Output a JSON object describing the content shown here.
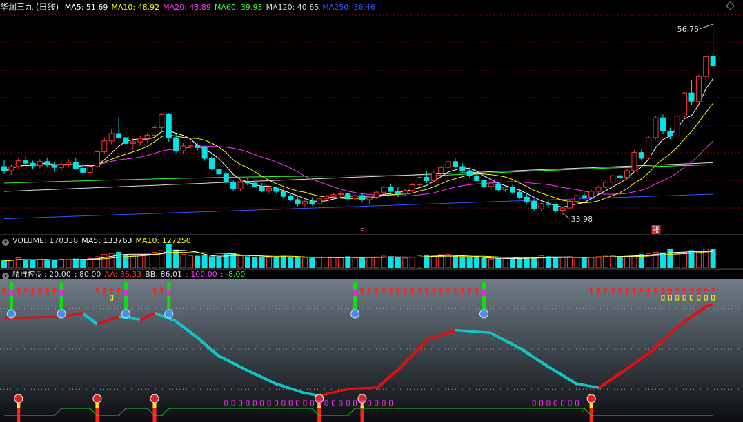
{
  "price_header": {
    "title": "华润三九 (日线)",
    "ma": [
      {
        "label": "MA5:",
        "value": "51.69",
        "color": "#ffffff"
      },
      {
        "label": "MA10:",
        "value": "48.92",
        "color": "#ffff00"
      },
      {
        "label": "MA20:",
        "value": "43.89",
        "color": "#ff33ff"
      },
      {
        "label": "MA60:",
        "value": "39.93",
        "color": "#33ff33"
      },
      {
        "label": "MA120:",
        "value": "40.65",
        "color": "#dddddd"
      },
      {
        "label": "MA250:",
        "value": "36.46",
        "color": "#3355ff"
      }
    ],
    "high_label": "56.75",
    "low_label": "33.98",
    "marker_s": "S",
    "marker_zhang": "涨"
  },
  "volume_header": {
    "items": [
      {
        "label": "VOLUME:",
        "value": "170338",
        "color": "#dddddd"
      },
      {
        "label": "MA5:",
        "value": "133763",
        "color": "#ffffff"
      },
      {
        "label": "MA10:",
        "value": "127250",
        "color": "#ffff00"
      }
    ]
  },
  "indicator_header": {
    "name": "精准控盘",
    "items": [
      {
        "text": ": 20.00",
        "color": "#dddddd"
      },
      {
        "text": ": 80.00",
        "color": "#dddddd"
      },
      {
        "text": "AA: 86.33",
        "color": "#ff3333"
      },
      {
        "text": "BB: 86.01",
        "color": "#dddddd"
      },
      {
        "text": ": 100.00",
        "color": "#ff33ff"
      },
      {
        "text": ": -8.00",
        "color": "#33ff33"
      }
    ]
  },
  "colors": {
    "up": "#ff3232",
    "down": "#00e5e5",
    "bg": "#000000",
    "grid": "#8b0000"
  },
  "chart_data": [
    {
      "type": "candlestick",
      "title": "华润三九 (日线)",
      "ylim": [
        32,
        58
      ],
      "note": "daily OHLC, 100 bars, values estimated from chart",
      "ohlc": [
        [
          39.5,
          40.3,
          38.6,
          39.0
        ],
        [
          39.0,
          39.8,
          38.5,
          39.5
        ],
        [
          39.5,
          40.5,
          39.2,
          40.2
        ],
        [
          40.2,
          40.8,
          39.6,
          39.9
        ],
        [
          39.9,
          40.2,
          39.2,
          39.6
        ],
        [
          39.6,
          40.4,
          39.3,
          40.1
        ],
        [
          40.1,
          40.6,
          39.5,
          39.7
        ],
        [
          39.7,
          40.0,
          39.0,
          39.4
        ],
        [
          39.4,
          40.1,
          39.0,
          39.8
        ],
        [
          39.8,
          40.4,
          39.4,
          40.0
        ],
        [
          40.0,
          40.5,
          39.1,
          39.3
        ],
        [
          39.3,
          39.9,
          38.6,
          38.8
        ],
        [
          38.8,
          39.7,
          38.5,
          39.5
        ],
        [
          39.5,
          41.5,
          39.3,
          41.3
        ],
        [
          41.3,
          43.0,
          41.0,
          42.6
        ],
        [
          42.6,
          44.0,
          42.2,
          43.5
        ],
        [
          43.5,
          45.5,
          42.8,
          43.0
        ],
        [
          43.0,
          43.6,
          42.0,
          42.3
        ],
        [
          42.3,
          43.0,
          41.5,
          42.5
        ],
        [
          42.5,
          43.2,
          42.0,
          42.9
        ],
        [
          42.9,
          43.6,
          42.3,
          43.3
        ],
        [
          43.3,
          44.5,
          42.9,
          44.2
        ],
        [
          44.2,
          46.0,
          43.8,
          45.8
        ],
        [
          45.8,
          46.0,
          42.5,
          43.0
        ],
        [
          43.0,
          43.5,
          41.2,
          41.4
        ],
        [
          41.4,
          42.4,
          41.0,
          42.0
        ],
        [
          42.0,
          42.6,
          41.6,
          42.1
        ],
        [
          42.1,
          42.4,
          41.5,
          41.8
        ],
        [
          41.8,
          42.0,
          40.2,
          40.5
        ],
        [
          40.5,
          40.8,
          39.0,
          39.2
        ],
        [
          39.2,
          39.6,
          38.4,
          38.6
        ],
        [
          38.6,
          38.9,
          37.4,
          37.6
        ],
        [
          37.6,
          37.9,
          36.5,
          36.8
        ],
        [
          36.8,
          38.0,
          36.5,
          37.6
        ],
        [
          37.6,
          38.1,
          37.2,
          37.5
        ],
        [
          37.5,
          37.8,
          36.9,
          37.1
        ],
        [
          37.1,
          37.5,
          36.4,
          36.6
        ],
        [
          36.6,
          37.2,
          36.2,
          36.9
        ],
        [
          36.9,
          37.1,
          36.3,
          36.5
        ],
        [
          36.5,
          36.9,
          35.7,
          35.9
        ],
        [
          35.9,
          36.2,
          35.3,
          35.5
        ],
        [
          35.5,
          35.9,
          34.7,
          35.0
        ],
        [
          35.0,
          35.6,
          34.6,
          35.3
        ],
        [
          35.3,
          35.8,
          34.8,
          35.0
        ],
        [
          35.0,
          35.7,
          34.8,
          35.6
        ],
        [
          35.6,
          36.1,
          35.4,
          35.9
        ],
        [
          35.9,
          36.3,
          35.6,
          36.1
        ],
        [
          36.1,
          36.5,
          35.8,
          36.2
        ],
        [
          36.2,
          36.7,
          35.4,
          35.6
        ],
        [
          35.6,
          36.2,
          35.4,
          36.0
        ],
        [
          36.0,
          36.3,
          35.2,
          35.5
        ],
        [
          35.5,
          36.0,
          35.0,
          35.8
        ],
        [
          35.8,
          36.5,
          35.6,
          36.4
        ],
        [
          36.4,
          37.2,
          36.2,
          37.0
        ],
        [
          37.0,
          37.4,
          36.3,
          36.5
        ],
        [
          36.5,
          37.0,
          35.8,
          36.2
        ],
        [
          36.2,
          36.8,
          36.0,
          36.6
        ],
        [
          36.6,
          37.5,
          36.4,
          37.3
        ],
        [
          37.3,
          38.3,
          37.1,
          38.2
        ],
        [
          38.2,
          39.0,
          37.5,
          37.8
        ],
        [
          37.8,
          38.9,
          37.6,
          38.7
        ],
        [
          38.7,
          39.6,
          38.5,
          39.4
        ],
        [
          39.4,
          40.3,
          39.2,
          40.1
        ],
        [
          40.1,
          40.5,
          39.3,
          39.5
        ],
        [
          39.5,
          39.9,
          38.8,
          39.0
        ],
        [
          39.0,
          39.4,
          38.2,
          38.4
        ],
        [
          38.4,
          38.8,
          37.6,
          37.8
        ],
        [
          37.8,
          38.0,
          36.9,
          37.1
        ],
        [
          37.1,
          37.6,
          36.6,
          37.4
        ],
        [
          37.4,
          37.7,
          36.5,
          36.7
        ],
        [
          36.7,
          37.2,
          36.4,
          37.0
        ],
        [
          37.0,
          37.3,
          36.2,
          36.4
        ],
        [
          36.4,
          36.8,
          35.6,
          35.8
        ],
        [
          35.8,
          36.2,
          35.0,
          35.3
        ],
        [
          35.3,
          35.6,
          34.2,
          34.4
        ],
        [
          34.4,
          35.2,
          34.1,
          35.0
        ],
        [
          35.0,
          35.4,
          34.6,
          34.9
        ],
        [
          34.9,
          35.0,
          34.0,
          34.2
        ],
        [
          34.2,
          34.6,
          33.98,
          34.5
        ],
        [
          34.5,
          35.5,
          34.4,
          35.3
        ],
        [
          35.3,
          36.2,
          35.1,
          36.0
        ],
        [
          36.0,
          36.6,
          35.6,
          35.8
        ],
        [
          35.8,
          36.7,
          35.7,
          36.5
        ],
        [
          36.5,
          37.2,
          36.3,
          37.0
        ],
        [
          37.0,
          37.8,
          36.8,
          37.6
        ],
        [
          37.6,
          38.6,
          37.4,
          38.4
        ],
        [
          38.4,
          39.0,
          37.9,
          38.2
        ],
        [
          38.2,
          39.2,
          38.0,
          39.0
        ],
        [
          39.0,
          41.5,
          38.8,
          41.2
        ],
        [
          41.2,
          41.6,
          40.2,
          40.5
        ],
        [
          40.5,
          43.2,
          40.3,
          43.0
        ],
        [
          43.0,
          45.6,
          42.8,
          45.4
        ],
        [
          45.4,
          45.8,
          43.5,
          43.8
        ],
        [
          43.8,
          44.2,
          42.8,
          43.2
        ],
        [
          43.2,
          45.8,
          43.0,
          45.6
        ],
        [
          45.6,
          48.6,
          45.4,
          48.4
        ],
        [
          48.4,
          50.0,
          47.0,
          47.4
        ],
        [
          47.4,
          50.6,
          47.2,
          50.4
        ],
        [
          50.4,
          53.0,
          50.0,
          52.8
        ],
        [
          52.8,
          56.75,
          51.6,
          51.7
        ]
      ],
      "ma_series": [
        {
          "name": "MA5",
          "color": "#ffffff"
        },
        {
          "name": "MA10",
          "color": "#ffff00"
        },
        {
          "name": "MA20",
          "color": "#ff33ff"
        },
        {
          "name": "MA60",
          "color": "#33ff33"
        },
        {
          "name": "MA120",
          "color": "#dddddd"
        },
        {
          "name": "MA250",
          "color": "#3355ff"
        }
      ]
    },
    {
      "type": "bar",
      "title": "VOLUME",
      "volume": [
        65,
        70,
        90,
        72,
        68,
        75,
        70,
        66,
        78,
        74,
        80,
        76,
        85,
        100,
        120,
        130,
        140,
        115,
        110,
        118,
        125,
        140,
        155,
        210,
        160,
        120,
        110,
        105,
        112,
        100,
        95,
        120,
        130,
        110,
        100,
        95,
        98,
        92,
        90,
        105,
        95,
        100,
        90,
        88,
        92,
        96,
        94,
        90,
        100,
        88,
        92,
        96,
        98,
        105,
        100,
        92,
        88,
        95,
        110,
        115,
        108,
        118,
        122,
        100,
        95,
        92,
        90,
        85,
        80,
        86,
        84,
        82,
        88,
        92,
        95,
        110,
        100,
        90,
        95,
        98,
        92,
        90,
        96,
        100,
        105,
        110,
        98,
        105,
        115,
        120,
        125,
        140,
        135,
        165,
        130,
        140,
        155,
        150,
        168,
        170
      ]
    }
  ]
}
